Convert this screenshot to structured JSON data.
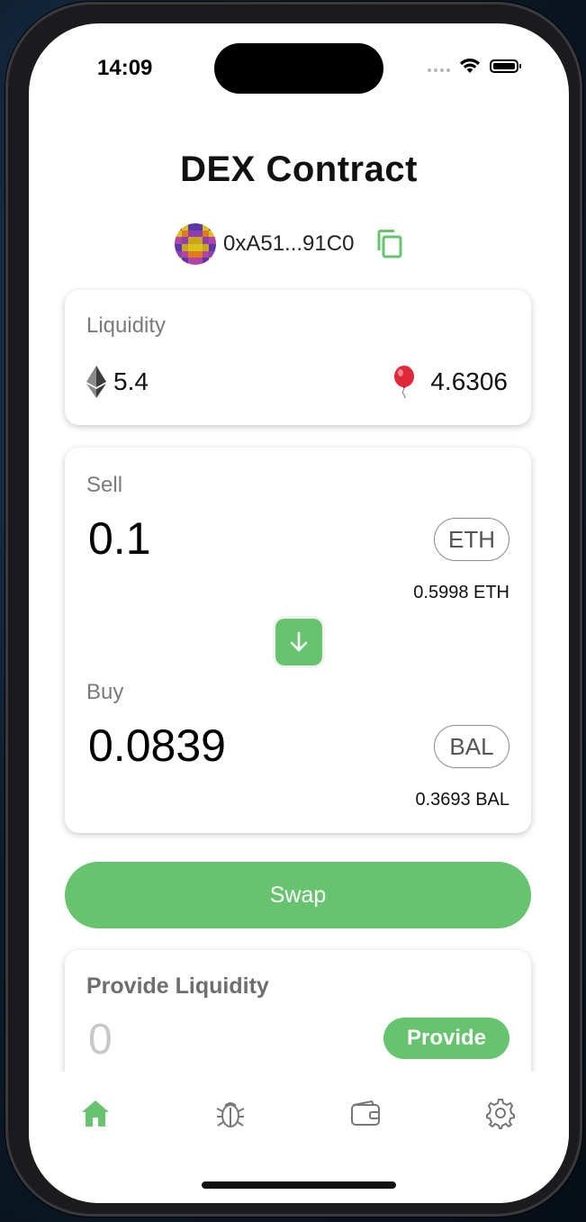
{
  "status_bar": {
    "time": "14:09"
  },
  "header": {
    "title": "DEX Contract",
    "address": "0xA51...91C0"
  },
  "liquidity": {
    "label": "Liquidity",
    "eth_amount": "5.4",
    "bal_amount": "4.6306"
  },
  "sell": {
    "label": "Sell",
    "amount": "0.1",
    "token": "ETH",
    "balance": "0.5998 ETH"
  },
  "buy": {
    "label": "Buy",
    "amount": "0.0839",
    "token": "BAL",
    "balance": "0.3693 BAL"
  },
  "swap_button": {
    "label": "Swap"
  },
  "provide": {
    "title": "Provide Liquidity",
    "placeholder": "0",
    "button_label": "Provide"
  },
  "tabs": [
    "home-icon",
    "bug-icon",
    "wallet-icon",
    "gear-icon"
  ],
  "colors": {
    "accent": "#66c46e",
    "tab_active": "#66c46e",
    "tab_inactive": "#777777"
  }
}
